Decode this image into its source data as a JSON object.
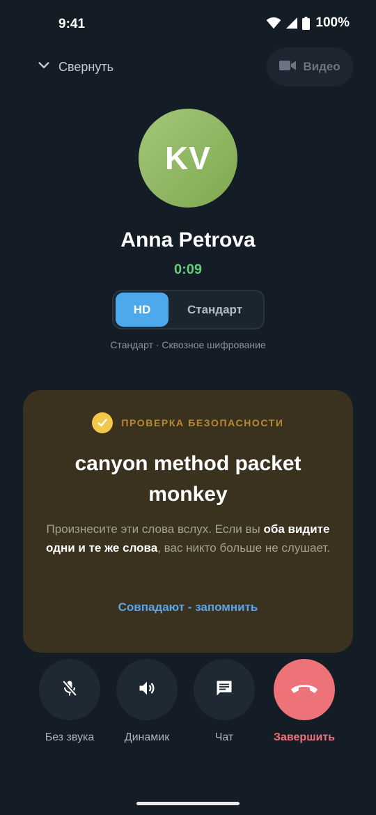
{
  "status_bar": {
    "time": "9:41",
    "battery": "100%"
  },
  "top_bar": {
    "collapse_label": "Свернуть",
    "video_label": "Видео"
  },
  "caller": {
    "initials": "KV",
    "name": "Anna Petrova",
    "duration": "0:09"
  },
  "quality": {
    "options": [
      "HD",
      "Стандарт"
    ],
    "selected": "HD",
    "subtitle": "Стандарт · Сквозное шифрование"
  },
  "security": {
    "title": "ПРОВЕРКА БЕЗОПАСНОСТИ",
    "words": "canyon method packet monkey",
    "desc_part1": "Произнесите эти слова вслух. Если вы ",
    "desc_bold": "оба видите одни и те же слова",
    "desc_part2": ", вас никто больше не слушает.",
    "action": "Совпадают - запомнить"
  },
  "controls": [
    {
      "label": "Без звука",
      "icon": "mic-off-icon"
    },
    {
      "label": "Динамик",
      "icon": "speaker-icon"
    },
    {
      "label": "Чат",
      "icon": "chat-icon"
    },
    {
      "label": "Завершить",
      "icon": "call-end-icon"
    }
  ],
  "colors": {
    "background": "#141c25",
    "accent": "#4ea8ec",
    "timer": "#5fcf7a",
    "end_call": "#ee7379",
    "security_card": "#3a311f",
    "security_title": "#b88a32"
  }
}
